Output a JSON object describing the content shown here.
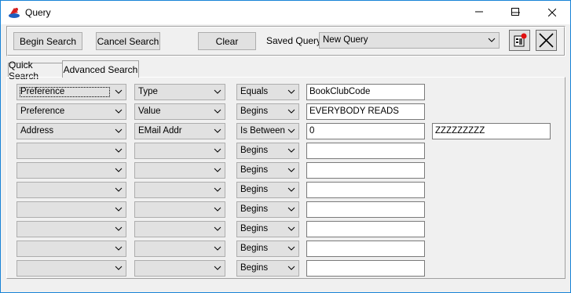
{
  "window": {
    "title": "Query"
  },
  "toolbar": {
    "begin_search": "Begin Search",
    "cancel_search": "Cancel Search",
    "clear": "Clear",
    "saved_query_label": "Saved Query:",
    "saved_query_value": "New Query"
  },
  "tabs": [
    {
      "label": "Quick Search",
      "active": false
    },
    {
      "label": "Advanced Search",
      "active": true
    }
  ],
  "rows": [
    {
      "field": "Preference",
      "subfield": "Type",
      "operator": "Equals",
      "value": "BookClubCode",
      "value2": ""
    },
    {
      "field": "Preference",
      "subfield": "Value",
      "operator": "Begins",
      "value": "EVERYBODY READS",
      "value2": ""
    },
    {
      "field": "Address",
      "subfield": "EMail Addr",
      "operator": "Is Between",
      "value": "0",
      "value2": "ZZZZZZZZZ"
    },
    {
      "field": "",
      "subfield": "",
      "operator": "Begins",
      "value": "",
      "value2": ""
    },
    {
      "field": "",
      "subfield": "",
      "operator": "Begins",
      "value": "",
      "value2": ""
    },
    {
      "field": "",
      "subfield": "",
      "operator": "Begins",
      "value": "",
      "value2": ""
    },
    {
      "field": "",
      "subfield": "",
      "operator": "Begins",
      "value": "",
      "value2": ""
    },
    {
      "field": "",
      "subfield": "",
      "operator": "Begins",
      "value": "",
      "value2": ""
    },
    {
      "field": "",
      "subfield": "",
      "operator": "Begins",
      "value": "",
      "value2": ""
    },
    {
      "field": "",
      "subfield": "",
      "operator": "Begins",
      "value": "",
      "value2": ""
    }
  ],
  "icons": {
    "app": "query-app-icon",
    "save": "save-query-icon",
    "delete": "delete-query-icon",
    "minimize": "minimize-icon",
    "maximize": "maximize-icon",
    "close": "close-icon",
    "dropdown": "chevron-down-icon"
  }
}
